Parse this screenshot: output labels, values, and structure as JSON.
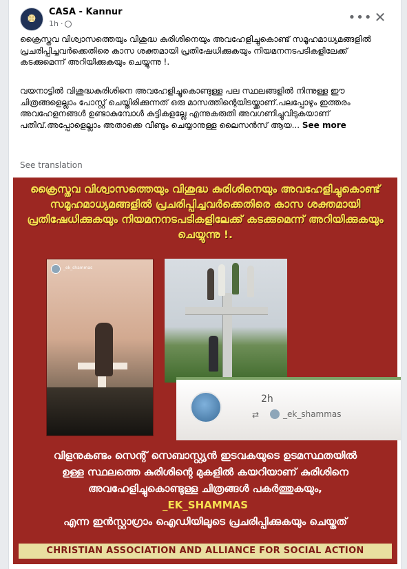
{
  "post": {
    "page_name": "CASA - Kannur",
    "time": "1h",
    "privacy_icon": "globe-icon",
    "more_icon": "more-options-icon",
    "close_icon": "close-icon",
    "paragraph1": "ക്രൈസ്തവ വിശ്വാസത്തെയും വിശുദ്ധ കുരിശിനെയും അവഹേളിച്ചുകൊണ്ട് സമൂഹമാധ്യമങ്ങളിൽ പ്രചരിപ്പിച്ചവർക്കെതിരെ കാസ ശക്തമായി പ്രതിഷേധിക്കുകയും നിയമനനടപടികളിലേക്ക് കടക്കുമെന്ന് അറിയിക്കുകയും ചെയ്യുന്നു !.",
    "paragraph2": "വയനാട്ടിൽ വിശുദ്ധകുരിശിനെ അവഹേളിച്ചുകൊണ്ടുള്ള പല സ്ഥലങ്ങളിൽ നിന്നുള്ള ഈ ചിത്രങ്ങളെല്ലാം പോസ്റ്റ്‌ ചെയ്തിരിക്കുന്നത് ഒരു മാസത്തിന്റെയിടയ്ക്കാണ്.പലപ്പോഴും ഇത്തരം അവഹേളനങ്ങൾ ഉണ്ടാകുമ്പോൾ കുട്ടികളല്ലേ എന്നുകരുതി അവഗണിച്ചുവിടുകയാണ് പതിവ്.അപ്പോളെല്ലാം അതാക്കെ വീണ്ടും ചെയ്യാനുള്ള ലൈസൻസ് ആയ...",
    "see_more": "See more",
    "see_translation": "See translation"
  },
  "image": {
    "heading": "ക്രൈസ്തവ വിശ്വാസത്തെയും വിശുദ്ധ കുരിശിനെയും അവഹേളിച്ചുകൊണ്ട് സമൂഹമാധ്യമങ്ങളിൽ പ്രചരിപ്പിച്ചവർക്കെതിരെ കാസ ശക്തമായി പ്രതിഷേധിക്കുകയും നിയമനനടപടികളിലേക്ക് കടക്കുമെന്ന് അറിയിക്കുകയും ചെയ്യുന്നു !.",
    "left_photo_username": "_ek_shammas",
    "story_time": "2h",
    "story_username": "_ek_shammas",
    "line1": "വിളനുകണ്ടം സെന്റ് സെബാസ്റ്റ്യൻ ഇടവകയുടെ ഉടമസ്ഥതയിൽ",
    "line2": "ഉള്ള സ്ഥലത്തെ കുരിശിന്റെ മുകളിൽ കയറിയാണ് കുരിശിനെ",
    "line3": "അവഹേളിച്ചുകൊണ്ടുള്ള ചിത്രങ്ങൾ പകർത്തുകയും,",
    "handle": "_EK_SHAMMAS",
    "line4": "എന്ന ഇൻസ്റ്റാഗ്രാം ഐഡിയിലൂടെ പ്രചരിപ്പിക്കുകയും ചെയ്തത്",
    "footer": "CHRISTIAN ASSOCIATION AND ALLIANCE FOR SOCIAL ACTION",
    "background_color": "#9c2722",
    "heading_color": "#f6e050"
  }
}
